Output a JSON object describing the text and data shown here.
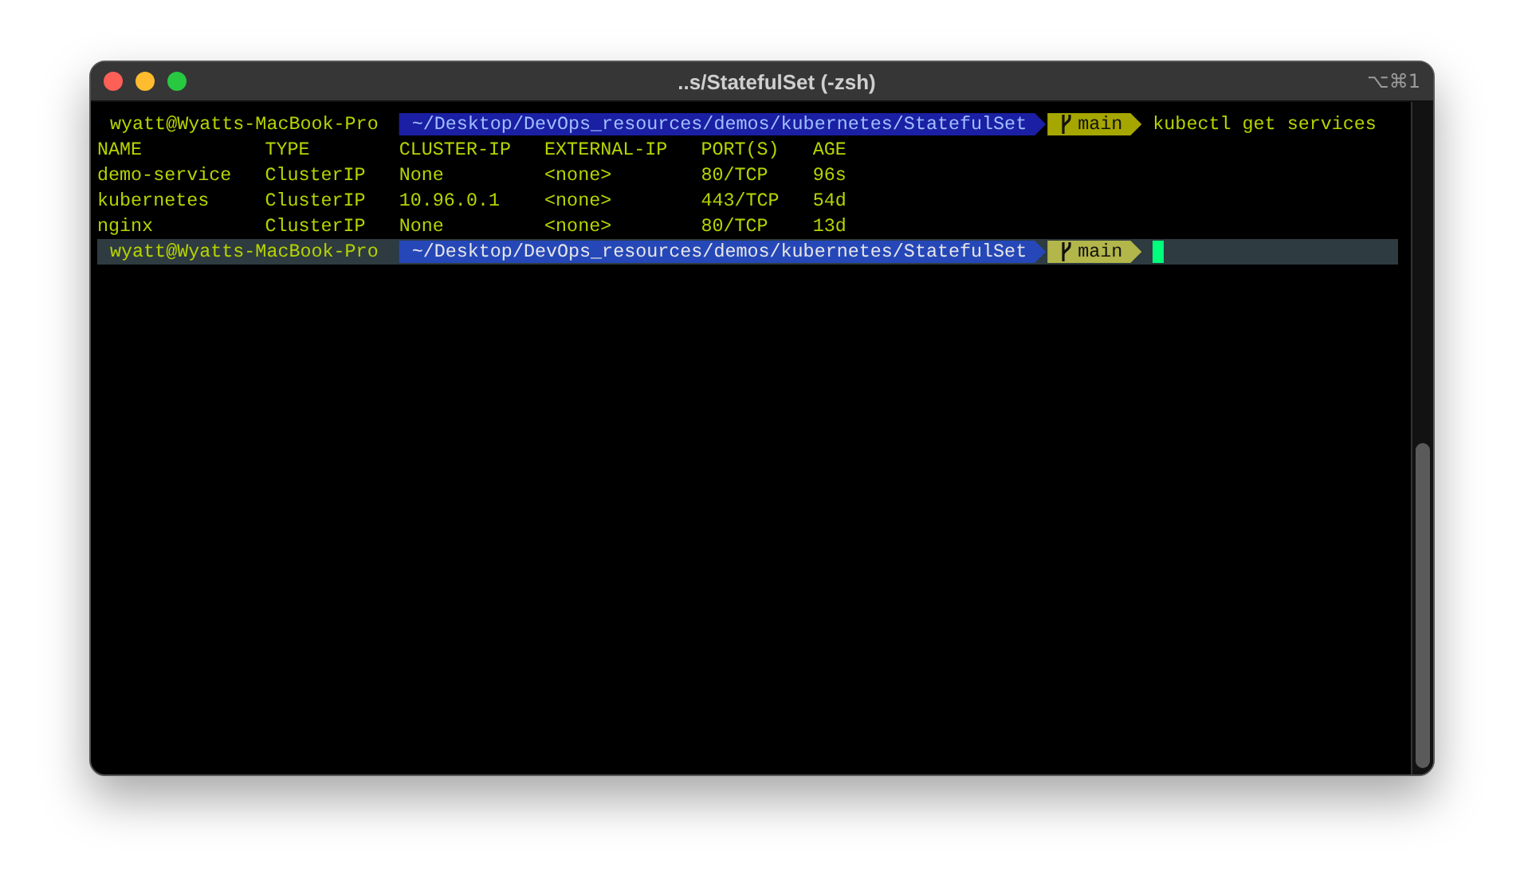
{
  "window": {
    "title": "..s/StatefulSet (-zsh)",
    "shortcut": "⌥⌘1"
  },
  "prompts": [
    {
      "user": "wyatt@Wyatts-MacBook-Pro",
      "path": "~/Desktop/DevOps_resources/demos/kubernetes/StatefulSet",
      "branch": "main",
      "command": "kubectl get services",
      "active": false
    },
    {
      "user": "wyatt@Wyatts-MacBook-Pro",
      "path": "~/Desktop/DevOps_resources/demos/kubernetes/StatefulSet",
      "branch": "main",
      "active": true
    }
  ],
  "table": {
    "columns": [
      "NAME",
      "TYPE",
      "CLUSTER-IP",
      "EXTERNAL-IP",
      "PORT(S)",
      "AGE"
    ],
    "rows": [
      [
        "demo-service",
        "ClusterIP",
        "None",
        "<none>",
        "80/TCP",
        "96s"
      ],
      [
        "kubernetes",
        "ClusterIP",
        "10.96.0.1",
        "<none>",
        "443/TCP",
        "54d"
      ],
      [
        "nginx",
        "ClusterIP",
        "None",
        "<none>",
        "80/TCP",
        "13d"
      ]
    ]
  }
}
